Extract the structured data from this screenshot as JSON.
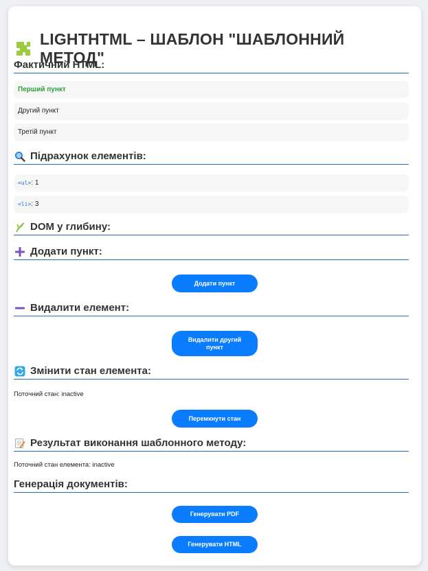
{
  "title": "LIGHTHTML – ШАБЛОН \"ШАБЛОННИЙ МЕТОД\"",
  "sections": {
    "actual_html": "Фактичний HTML:",
    "count": "Підрахунок елементів:",
    "dom_depth": "DOM у глибину:",
    "add": "Додати пункт:",
    "remove": "Видалити елемент:",
    "toggle": "Змінити стан елемента:",
    "result": "Результат виконання шаблонного методу:",
    "generation": "Генерація документів:"
  },
  "list_items": [
    "Перший пункт",
    "Другий пункт",
    "Третій пункт"
  ],
  "counts": [
    {
      "tag": "<ul>",
      "value": ": 1"
    },
    {
      "tag": "<li>",
      "value": ": 3"
    }
  ],
  "state_text": "Поточний стан: inactive",
  "result_text": "Поточний стан елемента: inactive",
  "buttons": {
    "add": "Додати пункт",
    "remove": "Видалити другий пункт",
    "toggle": "Перемкнути стан",
    "pdf": "Генерувати PDF",
    "html": "Генерувати HTML"
  },
  "icons": {
    "title": "puzzle-icon",
    "count": "magnifier-icon",
    "dom": "herb-icon",
    "add": "plus-icon",
    "remove": "minus-icon",
    "toggle": "refresh-icon",
    "result": "memo-icon"
  },
  "colors": {
    "accent": "#0a7cff",
    "rule": "#1f6fd1",
    "first_item": "#2e9e3e",
    "icon_purple": "#7b4fc4"
  }
}
